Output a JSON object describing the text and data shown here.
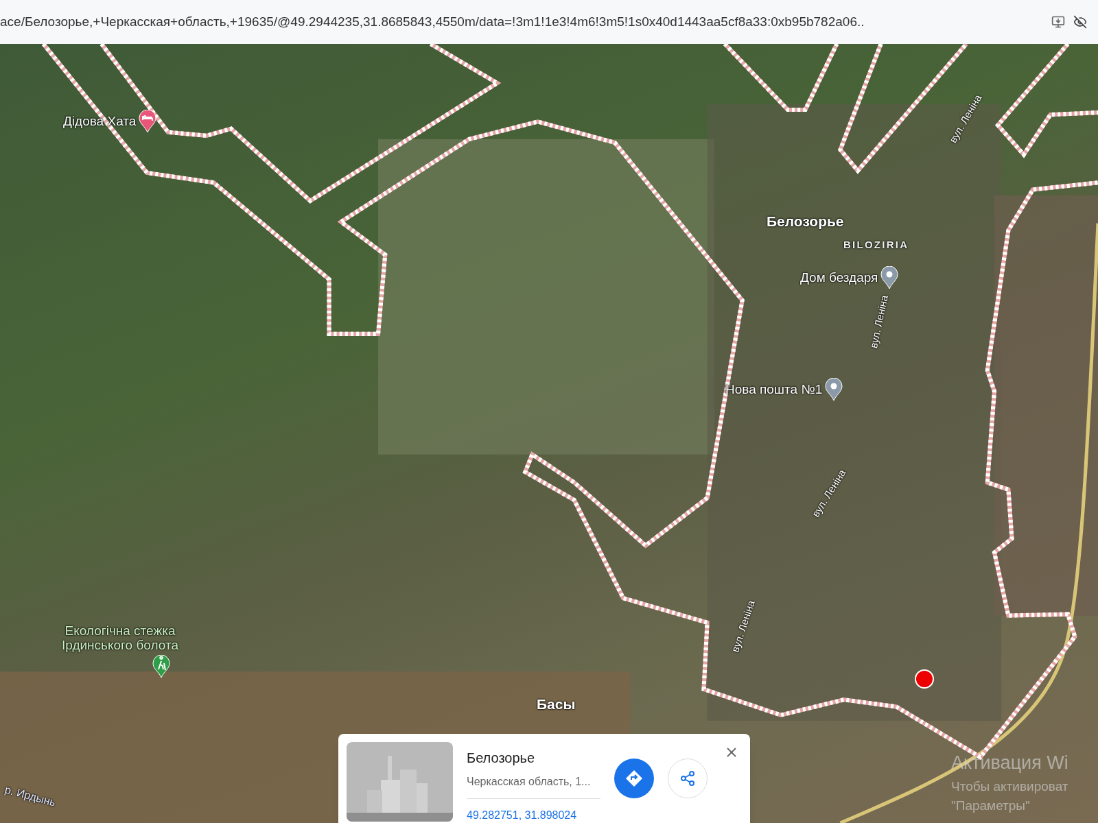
{
  "address_bar": {
    "url": "ace/Белозорье,+Черкасская+область,+19635/@49.2944235,31.8685843,4550m/data=!3m1!1e3!4m6!3m5!1s0x40d1443aa5cf8a33:0xb95b782a06.."
  },
  "map": {
    "places": [
      {
        "kind": "hotel",
        "text": "Дідова Хата"
      },
      {
        "kind": "town",
        "text": "Белозорье"
      },
      {
        "kind": "caption",
        "text": "BILOZIRIA"
      },
      {
        "kind": "pin",
        "text": "Дом бездаря"
      },
      {
        "kind": "pin",
        "text": "Нова пошта №1"
      },
      {
        "kind": "hike",
        "text": "Екологічна стежка Ірдинського болота"
      },
      {
        "kind": "town",
        "text": "Басы"
      }
    ],
    "streets": [
      "вул. Леніна",
      "вул. Леніна",
      "вул. Леніна",
      "вул. Леніна"
    ],
    "river": "р. Ирдынь"
  },
  "card": {
    "title": "Белозорье",
    "subtitle": "Черкасская область, 1...",
    "coordinates": "49.282751, 31.898024"
  },
  "os_watermark": [
    "Активация Wi",
    "Чтобы активироват",
    "\"Параметры\""
  ]
}
